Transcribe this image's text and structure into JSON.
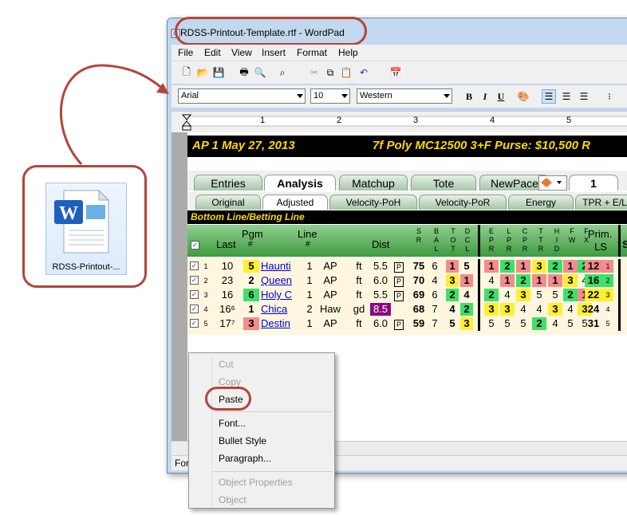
{
  "desktop": {
    "file_label": "RDSS-Printout-..."
  },
  "window": {
    "title": "RDSS-Printout-Template.rtf - WordPad"
  },
  "menu": [
    "File",
    "Edit",
    "View",
    "Insert",
    "Format",
    "Help"
  ],
  "format_bar": {
    "font": "Arial",
    "size": "10",
    "script": "Western",
    "bold": "B",
    "italic": "I",
    "underline": "U"
  },
  "ruler_numbers": [
    "1",
    "2",
    "3",
    "4",
    "5"
  ],
  "race": {
    "header": "AP 1   May 27, 2013",
    "header_right": "7f  Poly  MC12500  3+F   Purse: $10,500   R"
  },
  "tabs1": [
    "Entries",
    "Analysis",
    "Matchup",
    "Tote",
    "NewPace",
    "1"
  ],
  "tabs2": [
    "Original",
    "Adjusted",
    "Velocity-PoH",
    "Velocity-PoR",
    "Energy",
    "TPR + E/L"
  ],
  "section": "Bottom Line/Betting Line",
  "columns": {
    "last": "Last",
    "pgm": "Pgm",
    "pgm_sub": "#",
    "line": "Line",
    "line_sub": "#",
    "dist": "Dist",
    "prim": "Prim.",
    "prim_sub": "LS",
    "s": "S",
    "vert": [
      [
        "S",
        "R"
      ],
      [
        "B",
        "A",
        "L"
      ],
      [
        "T",
        "O",
        "T"
      ],
      [
        "D",
        "C",
        "L"
      ],
      [
        "E",
        "P",
        "R"
      ],
      [
        "L",
        "P",
        "R"
      ],
      [
        "C",
        "P",
        "R"
      ],
      [
        "T",
        "T",
        "R"
      ],
      [
        "H",
        "I",
        "D"
      ],
      [
        "F",
        "W"
      ],
      [
        "F",
        "X"
      ]
    ]
  },
  "rows": [
    {
      "n": "1",
      "last": "10",
      "pgm": "5",
      "name": "Haunti",
      "line": "1",
      "track": "AP",
      "surf": "ft",
      "dist": "5.5",
      "p": "P",
      "sr": "75",
      "bal": "6",
      "tot": "1",
      "dcl": "5",
      "vals": [
        "1",
        "2",
        "1",
        "3",
        "2",
        "1",
        "2"
      ],
      "prim": "12",
      "primsub": "1"
    },
    {
      "n": "2",
      "last": "23",
      "pgm": "2",
      "name": "Queen",
      "line": "1",
      "track": "AP",
      "surf": "ft",
      "dist": "6.0",
      "p": "P",
      "sr": "70",
      "bal": "4",
      "tot": "3",
      "dcl": "1",
      "vals": [
        "4",
        "1",
        "2",
        "1",
        "1",
        "3",
        "4"
      ],
      "prim": "16",
      "primsub": "2"
    },
    {
      "n": "3",
      "last": "16",
      "pgm": "6",
      "name": "Holy C",
      "line": "1",
      "track": "AP",
      "surf": "ft",
      "dist": "5.5",
      "p": "P",
      "sr": "69",
      "bal": "6",
      "tot": "2",
      "dcl": "4",
      "vals": [
        "2",
        "4",
        "3",
        "5",
        "5",
        "2",
        "1"
      ],
      "prim": "22",
      "primsub": "3"
    },
    {
      "n": "4",
      "last": "16⁶",
      "pgm": "1",
      "name": "Chica",
      "line": "2",
      "track": "Haw",
      "surf": "gd",
      "dist": "8.5",
      "p": "",
      "sr": "68",
      "bal": "7",
      "tot": "4",
      "dcl": "2",
      "vals": [
        "3",
        "3",
        "4",
        "4",
        "3",
        "4",
        "3"
      ],
      "prim": "24",
      "primsub": "4"
    },
    {
      "n": "5",
      "last": "17⁷",
      "pgm": "3",
      "name": "Destin",
      "line": "1",
      "track": "AP",
      "surf": "ft",
      "dist": "6.0",
      "p": "P",
      "sr": "59",
      "bal": "7",
      "tot": "5",
      "dcl": "3",
      "vals": [
        "5",
        "5",
        "5",
        "2",
        "4",
        "5",
        "5"
      ],
      "prim": "31",
      "primsub": "5"
    }
  ],
  "context_menu": {
    "cut": "Cut",
    "copy": "Copy",
    "paste": "Paste",
    "font": "Font...",
    "bullet": "Bullet Style",
    "paragraph": "Paragraph...",
    "objprops": "Object Properties",
    "object": "Object"
  },
  "status": "For",
  "colors": {
    "annotation": "#b5443a",
    "red": "#f38d8d",
    "green": "#3fe06a",
    "yellow": "#ffef2e",
    "purple": "#8b0a7e"
  }
}
